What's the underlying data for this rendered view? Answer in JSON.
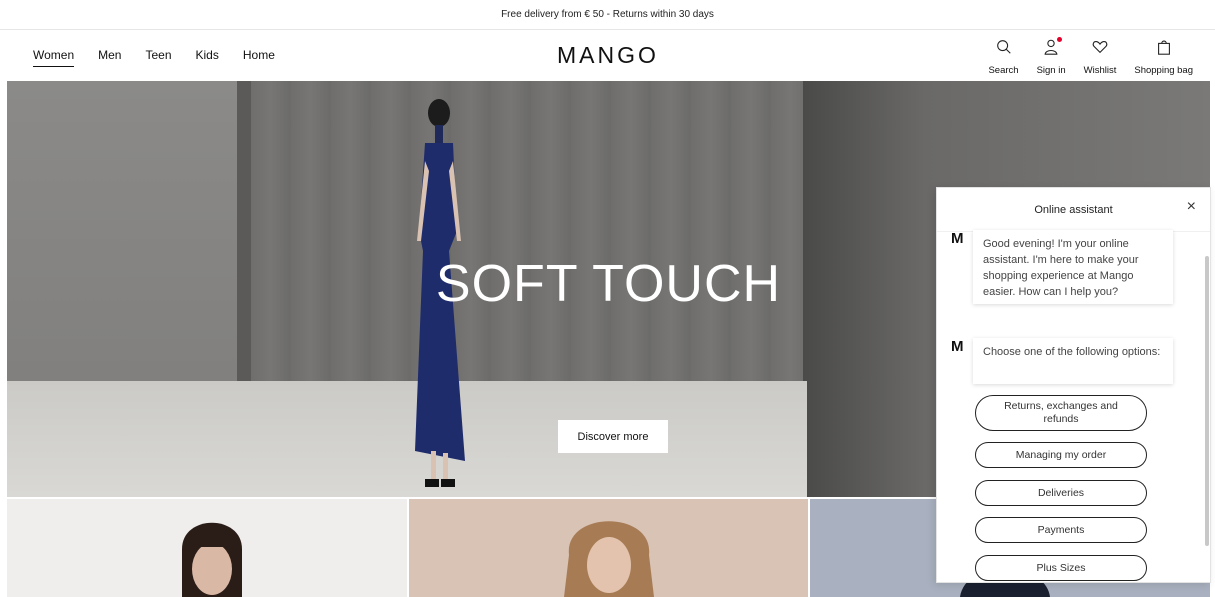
{
  "announcement": "Free delivery from € 50 - Returns within 30 days",
  "nav": {
    "items": [
      {
        "label": "Women",
        "active": true
      },
      {
        "label": "Men"
      },
      {
        "label": "Teen"
      },
      {
        "label": "Kids"
      },
      {
        "label": "Home"
      }
    ]
  },
  "logo": "MANGO",
  "actions": {
    "search": "Search",
    "sign_in": "Sign in",
    "wishlist": "Wishlist",
    "bag": "Shopping bag"
  },
  "hero": {
    "title": "SOFT TOUCH",
    "cta": "Discover more"
  },
  "chat": {
    "title": "Online assistant",
    "close": "×",
    "avatar": "M",
    "greeting": "Good evening! I'm your online assistant. I'm here to make your shopping experience at Mango easier. How can I help you?",
    "prompt": "Choose one of the following options:",
    "options": [
      "Returns, exchanges and refunds",
      "Managing my order",
      "Deliveries",
      "Payments",
      "Plus Sizes"
    ]
  },
  "colors": {
    "accent_dot": "#e4002b",
    "text": "#111111"
  }
}
